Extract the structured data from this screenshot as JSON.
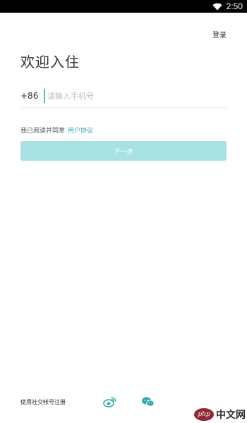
{
  "status_bar": {
    "time": "2:50",
    "wifi_icon": "wifi-icon"
  },
  "header": {
    "login_label": "登录"
  },
  "main": {
    "title": "欢迎入住",
    "country_code": "+86",
    "phone_placeholder": "请输入手机号",
    "phone_value": "",
    "agreement_text": "我已阅读并同意",
    "agreement_link": "用户协议",
    "next_label": "下一步"
  },
  "footer": {
    "social_label": "使用社交帐号注册",
    "weibo_icon": "weibo-icon",
    "wechat_icon": "wechat-icon"
  },
  "watermark": {
    "logo_text": "php",
    "text": "中文网"
  },
  "colors": {
    "accent": "#2fa9a9",
    "button_bg": "#a8e1e1",
    "status_bar": "#000000",
    "text": "#333333"
  }
}
